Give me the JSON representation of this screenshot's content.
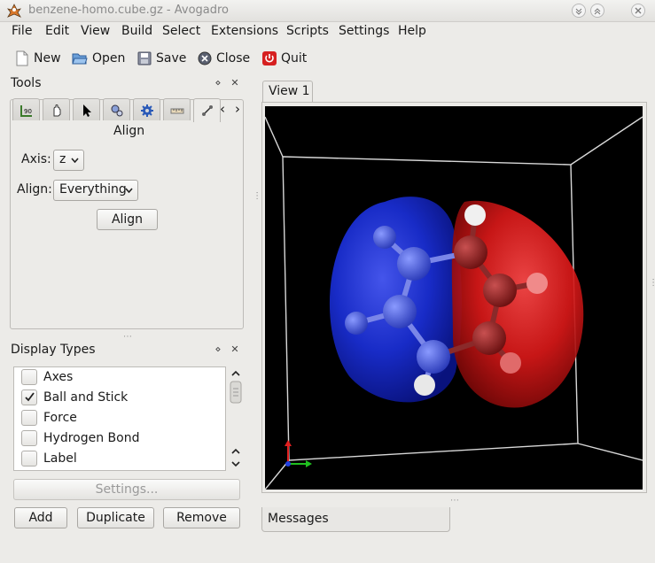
{
  "window": {
    "title": "benzene-homo.cube.gz - Avogadro"
  },
  "menubar": {
    "items": [
      "File",
      "Edit",
      "View",
      "Build",
      "Select",
      "Extensions",
      "Scripts",
      "Settings",
      "Help"
    ]
  },
  "toolbar": {
    "new_label": "New",
    "open_label": "Open",
    "save_label": "Save",
    "close_label": "Close",
    "quit_label": "Quit"
  },
  "tools_dock": {
    "title": "Tools",
    "tab_icons": [
      "bond-centric-manipulate-icon",
      "manipulate-icon",
      "navigate-icon",
      "auto-optimize-icon",
      "settings-icon",
      "measure-icon",
      "align-icon"
    ],
    "active_tool": "Align",
    "axis_label": "Axis:",
    "axis_value": "z",
    "align_label": "Align:",
    "align_value": "Everything",
    "align_button": "Align"
  },
  "display_types": {
    "title": "Display Types",
    "items": [
      {
        "label": "Axes",
        "checked": false
      },
      {
        "label": "Ball and Stick",
        "checked": true
      },
      {
        "label": "Force",
        "checked": false
      },
      {
        "label": "Hydrogen Bond",
        "checked": false
      },
      {
        "label": "Label",
        "checked": false
      }
    ],
    "settings_button": "Settings...",
    "add_button": "Add",
    "duplicate_button": "Duplicate",
    "remove_button": "Remove"
  },
  "view": {
    "tab_label": "View 1",
    "orbital_colors": {
      "positive": "#1a2fd8",
      "negative": "#d81818"
    }
  },
  "messages": {
    "tab_label": "Messages"
  }
}
